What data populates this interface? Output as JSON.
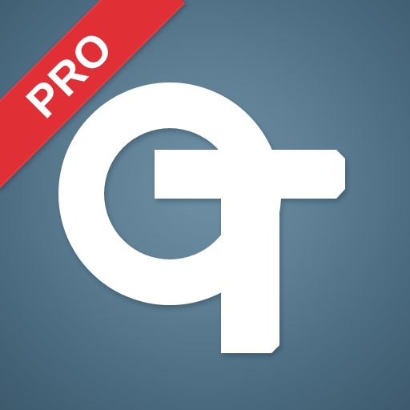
{
  "icon": {
    "badge_label": "PRO",
    "logo_icon": "qt-monogram-icon",
    "colors": {
      "background_center": "#6f90a4",
      "background_edge": "#3d5a6d",
      "badge": "#e02f35",
      "logo": "#ffffff"
    }
  }
}
